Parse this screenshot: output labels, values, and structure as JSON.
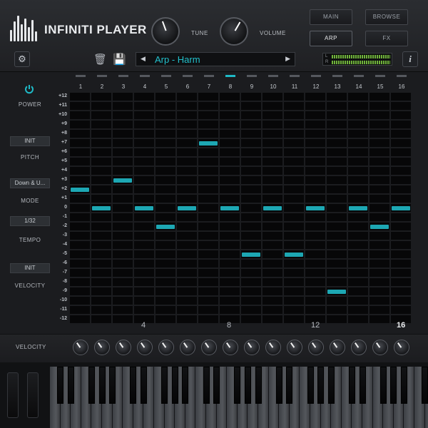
{
  "header": {
    "app_title": "INFINITI PLAYER",
    "knobs": [
      {
        "label": "TUNE"
      },
      {
        "label": "VOLUME"
      }
    ],
    "tabs": [
      {
        "label": "MAIN",
        "active": false
      },
      {
        "label": "BROWSE",
        "active": false
      },
      {
        "label": "ARP",
        "active": true
      },
      {
        "label": "FX",
        "active": false
      }
    ],
    "preset": {
      "name": "Arp - Harm",
      "prev_icon": "triangle-left",
      "next_icon": "triangle-right"
    },
    "meter": {
      "left_label": "L",
      "right_label": "R"
    },
    "info_label": "i",
    "icons": [
      "gear-icon",
      "trash-icon",
      "save-icon",
      "info-icon"
    ]
  },
  "side": {
    "power_label": "POWER",
    "pitch_value": "INIT",
    "pitch_label": "PITCH",
    "mode_value": "Down & U...",
    "mode_label": "MODE",
    "tempo_value": "1/32",
    "tempo_label": "TEMPO",
    "velocity_value": "INIT",
    "velocity_label": "VELOCITY"
  },
  "sequencer": {
    "steps": [
      "1",
      "2",
      "3",
      "4",
      "5",
      "6",
      "7",
      "8",
      "9",
      "10",
      "11",
      "12",
      "13",
      "14",
      "15",
      "16"
    ],
    "active_step": 8,
    "row_labels": [
      "+12",
      "+11",
      "+10",
      "+9",
      "+8",
      "+7",
      "+6",
      "+5",
      "+4",
      "+3",
      "+2",
      "+1",
      "0",
      "-1",
      "-2",
      "-3",
      "-4",
      "-5",
      "-6",
      "-7",
      "-8",
      "-9",
      "-10",
      "-11",
      "-12"
    ],
    "notes": [
      2,
      0,
      3,
      0,
      -2,
      0,
      7,
      0,
      -5,
      0,
      -5,
      0,
      -9,
      0,
      -2,
      0
    ],
    "group_numbers": [
      "4",
      "8",
      "12",
      "16"
    ]
  },
  "velocity_row": {
    "label": "VELOCITY",
    "knob_count": 16
  },
  "colors": {
    "accent": "#1da7b3",
    "background": "#1b1c1f",
    "cell": "#070708"
  }
}
